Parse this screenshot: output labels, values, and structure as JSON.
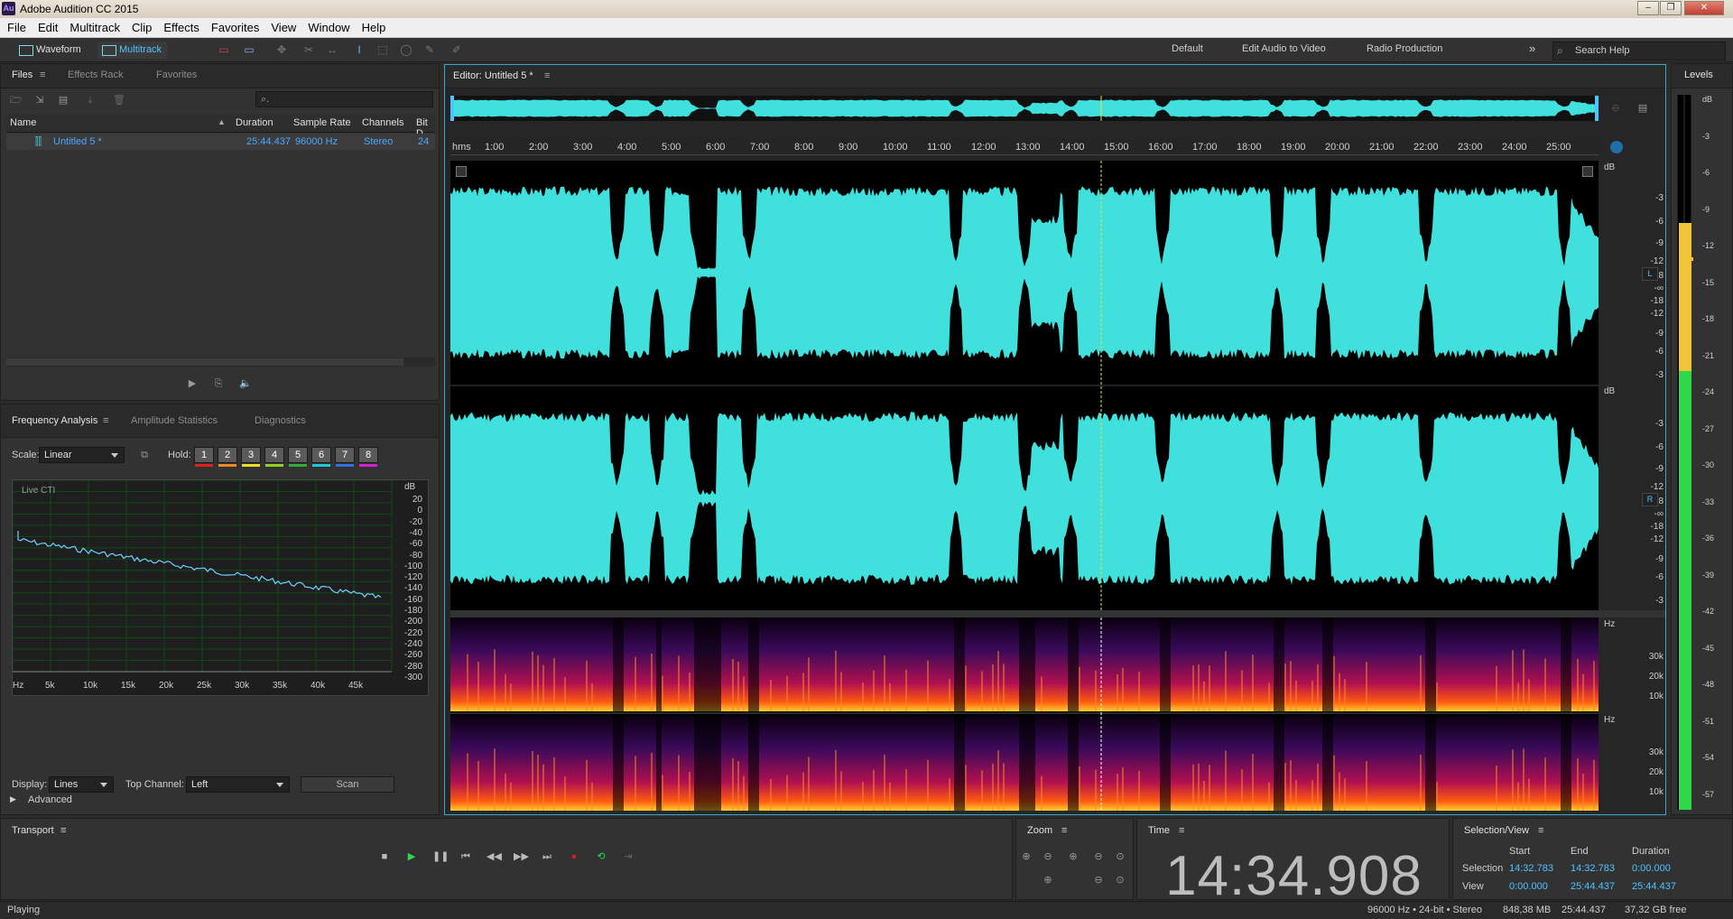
{
  "app": {
    "title": "Adobe Audition CC 2015",
    "logo": "Au"
  },
  "menu": [
    "File",
    "Edit",
    "Multitrack",
    "Clip",
    "Effects",
    "Favorites",
    "View",
    "Window",
    "Help"
  ],
  "toolbar": {
    "waveform": "Waveform",
    "multitrack": "Multitrack",
    "workspaces": [
      "Default",
      "Edit Audio to Video",
      "Radio Production"
    ],
    "more": "»",
    "search_placeholder": "Search Help"
  },
  "files_panel": {
    "tabs": [
      "Files",
      "Effects Rack",
      "Favorites"
    ],
    "search_glyph": "⌕.",
    "columns": [
      "Name",
      "Duration",
      "Sample Rate",
      "Channels",
      "Bit D"
    ],
    "rows": [
      {
        "name": "Untitled 5 *",
        "duration": "25:44.437",
        "sample_rate": "96000 Hz",
        "channels": "Stereo",
        "bit_depth": "24"
      }
    ]
  },
  "analysis_panel": {
    "tabs": [
      "Frequency Analysis",
      "Amplitude Statistics",
      "Diagnostics"
    ],
    "scale_label": "Scale:",
    "scale_value": "Linear",
    "hold_label": "Hold:",
    "hold_buttons": [
      "1",
      "2",
      "3",
      "4",
      "5",
      "6",
      "7",
      "8"
    ],
    "hold_colors": [
      "#e02020",
      "#f08a20",
      "#e8e020",
      "#90d020",
      "#30b030",
      "#20c8d8",
      "#3070e0",
      "#d020d0"
    ],
    "graph_label": "Live CTI",
    "db_unit": "dB",
    "db_ticks": [
      "20",
      "0",
      "-20",
      "-40",
      "-60",
      "-80",
      "-100",
      "-120",
      "-140",
      "-160",
      "-180",
      "-200",
      "-220",
      "-240",
      "-260",
      "-280",
      "-300"
    ],
    "hz_ticks": [
      "Hz",
      "5k",
      "10k",
      "15k",
      "20k",
      "25k",
      "30k",
      "35k",
      "40k",
      "45k"
    ],
    "display_label": "Display:",
    "display_value": "Lines",
    "top_channel_label": "Top Channel:",
    "top_channel_value": "Left",
    "scan_label": "Scan",
    "advanced_label": "Advanced"
  },
  "editor": {
    "title": "Editor: Untitled 5 *",
    "ruler_unit": "hms",
    "ruler": [
      "1:00",
      "2:00",
      "3:00",
      "4:00",
      "5:00",
      "6:00",
      "7:00",
      "8:00",
      "9:00",
      "10:00",
      "11:00",
      "12:00",
      "13:00",
      "14:00",
      "15:00",
      "16:00",
      "17:00",
      "18:00",
      "19:00",
      "20:00",
      "21:00",
      "22:00",
      "23:00",
      "24:00",
      "25:00"
    ],
    "db_label": "dB",
    "db_scale": [
      "-3",
      "-6",
      "-9",
      "-12",
      "-18",
      "-∞",
      "-18",
      "-12",
      "-9",
      "-6",
      "-3"
    ],
    "channel_left": "L",
    "channel_right": "R",
    "hz_label": "Hz",
    "spec_scale": [
      "30k",
      "20k",
      "10k"
    ],
    "playhead_time_s": 874.9,
    "total_time_s": 1544.437,
    "wave_color": "#40e0dc"
  },
  "levels": {
    "title": "Levels",
    "scale": [
      "dB",
      "-3",
      "-6",
      "-9",
      "-12",
      "-15",
      "-18",
      "-21",
      "-24",
      "-27",
      "-30",
      "-33",
      "-36",
      "-39",
      "-42",
      "-45",
      "-48",
      "-51",
      "-54",
      "-57",
      "dB"
    ]
  },
  "transport": {
    "title": "Transport"
  },
  "zoom": {
    "title": "Zoom"
  },
  "time": {
    "title": "Time",
    "value": "14:34.908"
  },
  "selection_view": {
    "title": "Selection/View",
    "headers": [
      "Start",
      "End",
      "Duration"
    ],
    "selection_label": "Selection",
    "selection": [
      "14:32.783",
      "14:32.783",
      "0:00.000"
    ],
    "view_label": "View",
    "view": [
      "0:00.000",
      "25:44.437",
      "25:44.437"
    ]
  },
  "status": {
    "state": "Playing",
    "format": "96000 Hz • 24-bit • Stereo",
    "size": "848,38 MB",
    "duration": "25:44.437",
    "free": "37,32 GB free"
  }
}
